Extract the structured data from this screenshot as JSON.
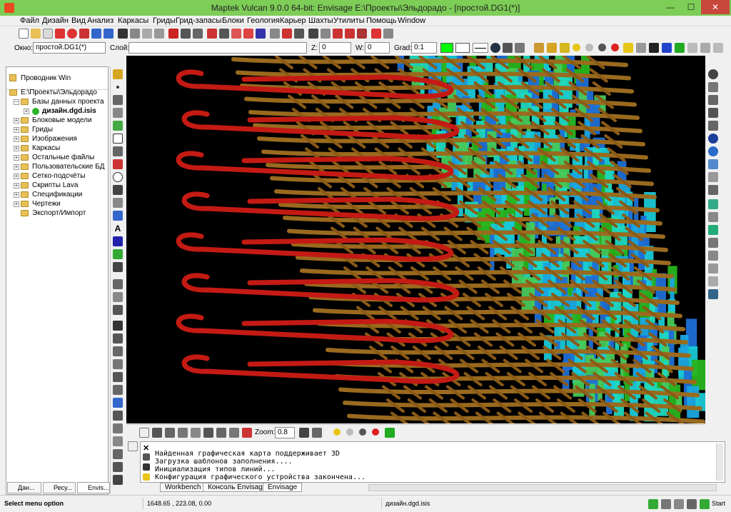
{
  "window": {
    "title": "Maptek Vulcan 9.0.0 64-bit: Envisage  E:\\Проекты\\Эльдорадо - [простой.DG1(*)]",
    "minimize": "—",
    "maximize": "☐",
    "close": "✕"
  },
  "menu": [
    "Файл",
    "Дизайн",
    "Вид",
    "Анализ",
    "Каркасы",
    "Гриды",
    "Грид-запасы",
    "Блоки",
    "Геология",
    "Карьер",
    "Шахты",
    "Утилиты",
    "Помощь",
    "Window"
  ],
  "props": {
    "window_label": "Окно:",
    "window_value": "простой.DG1(*)",
    "layer_label": "Слой:",
    "layer_value": "",
    "z_label": "Z:",
    "z_value": "0",
    "w_label": "W:",
    "w_value": "0",
    "grad_label": "Grad:",
    "grad_value": "0:1",
    "color_value": "#00ff00"
  },
  "explorer": {
    "title": "Проводник Win",
    "root": "E:\\Проекты\\Эльдорадо",
    "items": [
      {
        "label": "Базы данных проекта",
        "bold": false
      },
      {
        "label": "дизайн.dgd.isis",
        "bold": true
      },
      {
        "label": "Блоковые модели",
        "bold": false
      },
      {
        "label": "Гриды",
        "bold": false
      },
      {
        "label": "Изображения",
        "bold": false
      },
      {
        "label": "Каркасы",
        "bold": false
      },
      {
        "label": "Остальные файлы",
        "bold": false
      },
      {
        "label": "Пользовательские БД",
        "bold": false
      },
      {
        "label": "Сетко-подсчёты",
        "bold": false
      },
      {
        "label": "Скрипты Lava",
        "bold": false
      },
      {
        "label": "Спецификации",
        "bold": false
      },
      {
        "label": "Чертежи",
        "bold": false
      },
      {
        "label": "Экспорт/Импорт",
        "bold": false
      }
    ]
  },
  "left_tabs": [
    "Дан...",
    "Ресу...",
    "Envis..."
  ],
  "drawbar": {
    "zoom_label": "Zoom:",
    "zoom_value": "0.8"
  },
  "console": {
    "lines": [
      "Найденная графическая карта поддерживает 3D",
      "Загрузка шаблонов заполнения....",
      "Инициализация типов линий...",
      "Конфигурация графического устройства закончена..."
    ]
  },
  "console_tabs": [
    "Workbench",
    "Консоль Envisage",
    "Envisage"
  ],
  "status": {
    "hint": "Select menu option",
    "coords": "1648.65 , 223.08, 0.00",
    "database": "дизайн.dgd.isis",
    "start": "Start"
  },
  "colors": {
    "titlebar": "#7dcd57",
    "ramp": "#c41a14",
    "drift": "#9a6a1e",
    "block_cyan": "#19c8d6",
    "block_green": "#28b41e",
    "block_blue": "#1e6fd6"
  }
}
